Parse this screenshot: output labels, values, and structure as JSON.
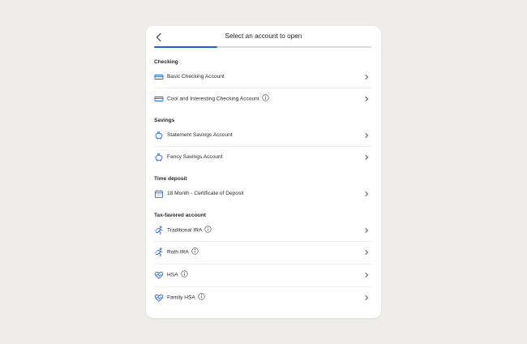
{
  "header": {
    "title": "Select an account to open",
    "back_icon": "chevron-left-icon",
    "progress_fraction": 0.29
  },
  "accent_color": "#1f5fd6",
  "sections": [
    {
      "title": "Checking",
      "items": [
        {
          "label": "Basic Checking Account",
          "icon": "card-icon",
          "info": false
        },
        {
          "label": "Cool and Interesting Checking Account",
          "icon": "card-icon",
          "info": true
        }
      ]
    },
    {
      "title": "Savings",
      "items": [
        {
          "label": "Statement Savings Account",
          "icon": "piggy-bank-icon",
          "info": false
        },
        {
          "label": "Fancy Savings Account",
          "icon": "piggy-bank-icon",
          "info": false
        }
      ]
    },
    {
      "title": "Time deposit",
      "items": [
        {
          "label": "18 Month - Certificate of Deposit",
          "icon": "calendar-icon",
          "info": false
        }
      ]
    },
    {
      "title": "Tax-favored account",
      "items": [
        {
          "label": "Traditional IRA",
          "icon": "runner-icon",
          "info": true
        },
        {
          "label": "Roth IRA",
          "icon": "runner-icon",
          "info": true
        },
        {
          "label": "HSA",
          "icon": "heart-pulse-icon",
          "info": true
        },
        {
          "label": "Family HSA",
          "icon": "heart-pulse-icon",
          "info": true
        }
      ]
    }
  ]
}
